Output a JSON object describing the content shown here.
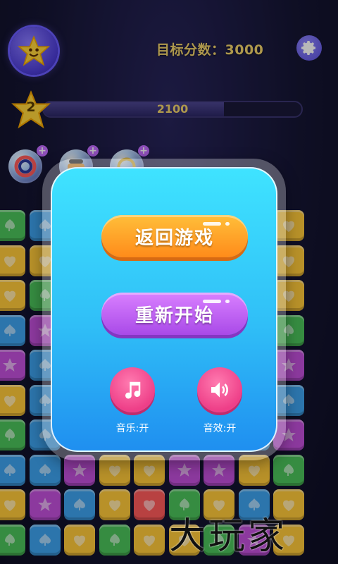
{
  "header": {
    "target_score_text": "目标分数：3000",
    "avatar_icon": "star-face-icon",
    "settings_icon": "gear-icon"
  },
  "level": {
    "number": "2",
    "score": "2100",
    "progress_fraction": 0.7
  },
  "boosters": [
    {
      "icon": "rainbow-bomb-icon",
      "plus": "+"
    },
    {
      "icon": "hammer-icon",
      "plus": "+"
    },
    {
      "icon": "refresh-icon",
      "plus": "+"
    }
  ],
  "pause_dialog": {
    "resume_label": "返回游戏",
    "restart_label": "重新开始",
    "music_label": "音乐:开",
    "sound_label": "音效:开",
    "music_icon": "music-note-icon",
    "sound_icon": "speaker-icon"
  },
  "watermark": "大玩家",
  "colors": {
    "resume_button": "#ff9b22",
    "restart_button": "#b857ee",
    "dialog_panel": "#30bff7",
    "toggle_button": "#ee3f88",
    "score_text": "#f2d36b"
  }
}
